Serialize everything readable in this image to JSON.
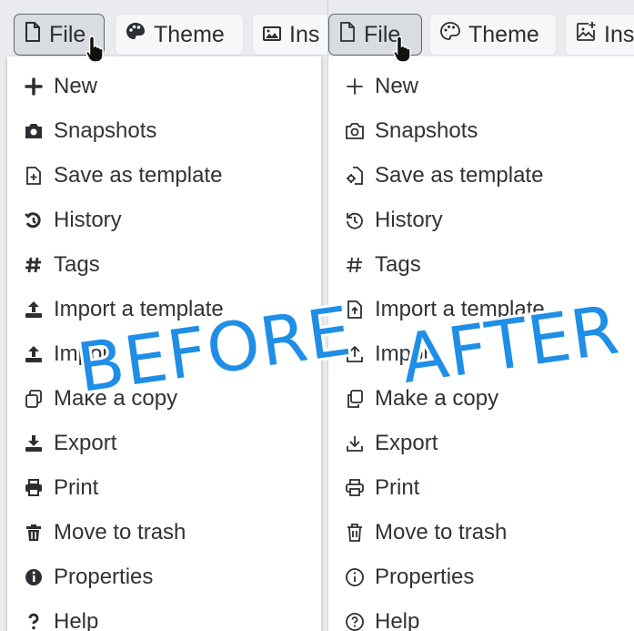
{
  "toolbar": {
    "file_label": "File",
    "theme_label": "Theme",
    "insert_label_before": "Ins",
    "insert_label_after": "Ins"
  },
  "menu": {
    "items": [
      {
        "label": "New",
        "icon": "plus-icon"
      },
      {
        "label": "Snapshots",
        "icon": "camera-icon"
      },
      {
        "label": "Save as template",
        "icon": "file-plus-icon"
      },
      {
        "label": "History",
        "icon": "history-icon"
      },
      {
        "label": "Tags",
        "icon": "hashtag-icon"
      },
      {
        "label": "Import a template",
        "icon": "upload-icon"
      },
      {
        "label": "Import",
        "icon": "upload-icon"
      },
      {
        "label": "Make a copy",
        "icon": "copy-icon"
      },
      {
        "label": "Export",
        "icon": "download-icon"
      },
      {
        "label": "Print",
        "icon": "printer-icon"
      },
      {
        "label": "Move to trash",
        "icon": "trash-icon"
      },
      {
        "label": "Properties",
        "icon": "info-icon"
      },
      {
        "label": "Help",
        "icon": "question-icon"
      }
    ]
  },
  "overlays": {
    "before": "BEFORE",
    "after": "AFTER"
  },
  "colors": {
    "overlay_text": "#1f8ee6",
    "background": "#e9ebee",
    "menu_bg": "#ffffff"
  }
}
